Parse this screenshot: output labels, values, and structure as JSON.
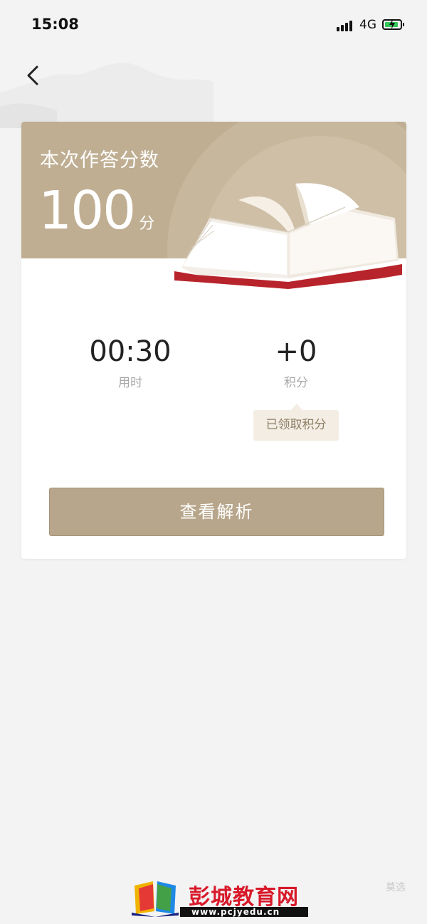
{
  "status_bar": {
    "time": "15:08",
    "network": "4G"
  },
  "header": {
    "back_icon": "chevron-left-icon"
  },
  "result_card": {
    "banner_title": "本次作答分数",
    "score": "100",
    "score_unit": "分",
    "stats": [
      {
        "value": "00:30",
        "label": "用时"
      },
      {
        "value": "+0",
        "label": "积分"
      }
    ],
    "points_tip": "已领取积分",
    "analysis_button": "查看解析"
  },
  "watermark": {
    "name": "彭城教育网",
    "url": "www.pcjyedu.cn",
    "url_visible": "www.pcjyedu.",
    "brand": "莫选"
  },
  "colors": {
    "banner": "#bfae92",
    "button": "#b7a68b",
    "tip_background": "#f3ede4",
    "page_background": "#f3f3f3"
  }
}
